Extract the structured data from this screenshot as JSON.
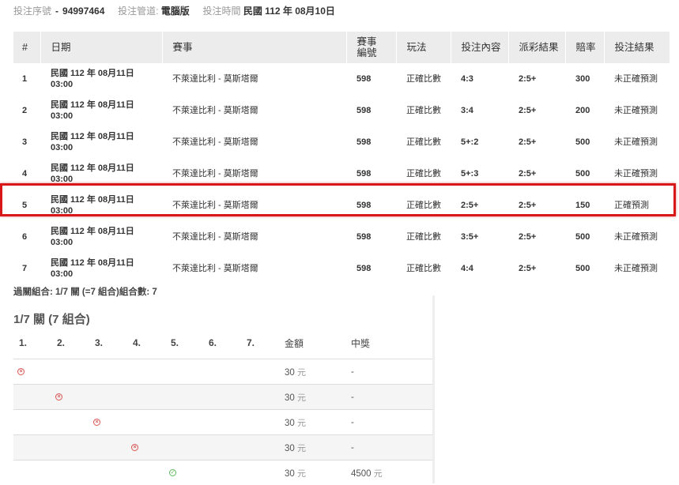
{
  "header": {
    "serial_label": "投注序號",
    "serial_value": "94997464",
    "channel_label": "投注管道:",
    "channel_value": "電腦版",
    "time_label": "投注時間",
    "time_value": "民國 112 年 08月10日"
  },
  "main_table": {
    "headers": [
      "#",
      "日期",
      "賽事",
      "賽事編號",
      "玩法",
      "投注內容",
      "派彩結果",
      "賠率",
      "投注結果"
    ],
    "rows": [
      {
        "num": "1",
        "date": "民國 112 年 08月11日",
        "time": "03:00",
        "event": "不萊達比利 - 莫斯塔爾",
        "code": "598",
        "play": "正確比數",
        "bet": "4:3",
        "payout": "2:5+",
        "odds": "300",
        "result": "未正確預測"
      },
      {
        "num": "2",
        "date": "民國 112 年 08月11日",
        "time": "03:00",
        "event": "不萊達比利 - 莫斯塔爾",
        "code": "598",
        "play": "正確比數",
        "bet": "3:4",
        "payout": "2:5+",
        "odds": "200",
        "result": "未正確預測"
      },
      {
        "num": "3",
        "date": "民國 112 年 08月11日",
        "time": "03:00",
        "event": "不萊達比利 - 莫斯塔爾",
        "code": "598",
        "play": "正確比數",
        "bet": "5+:2",
        "payout": "2:5+",
        "odds": "500",
        "result": "未正確預測"
      },
      {
        "num": "4",
        "date": "民國 112 年 08月11日",
        "time": "03:00",
        "event": "不萊達比利 - 莫斯塔爾",
        "code": "598",
        "play": "正確比數",
        "bet": "5+:3",
        "payout": "2:5+",
        "odds": "500",
        "result": "未正確預測"
      },
      {
        "num": "5",
        "date": "民國 112 年 08月11日",
        "time": "03:00",
        "event": "不萊達比利 - 莫斯塔爾",
        "code": "598",
        "play": "正確比數",
        "bet": "2:5+",
        "payout": "2:5+",
        "odds": "150",
        "result": "正確預測"
      },
      {
        "num": "6",
        "date": "民國 112 年 08月11日",
        "time": "03:00",
        "event": "不萊達比利 - 莫斯塔爾",
        "code": "598",
        "play": "正確比數",
        "bet": "3:5+",
        "payout": "2:5+",
        "odds": "500",
        "result": "未正確預測"
      },
      {
        "num": "7",
        "date": "民國 112 年 08月11日",
        "time": "03:00",
        "event": "不萊達比利 - 莫斯塔爾",
        "code": "598",
        "play": "正確比數",
        "bet": "4:4",
        "payout": "2:5+",
        "odds": "500",
        "result": "未正確預測"
      }
    ]
  },
  "summary": "過關組合: 1/7 關 (=7 組合)組合數: 7",
  "combo": {
    "title": "1/7 關 (7 組合)",
    "headers": [
      "1.",
      "2.",
      "3.",
      "4.",
      "5.",
      "6.",
      "7.",
      "金額",
      "中獎"
    ],
    "currency": "元",
    "rows": [
      {
        "col": 0,
        "status": "x",
        "amount": "30",
        "win": "-"
      },
      {
        "col": 1,
        "status": "x",
        "amount": "30",
        "win": "-"
      },
      {
        "col": 2,
        "status": "x",
        "amount": "30",
        "win": "-"
      },
      {
        "col": 3,
        "status": "x",
        "amount": "30",
        "win": "-"
      },
      {
        "col": 4,
        "status": "ok",
        "amount": "30",
        "win": "4500"
      }
    ]
  },
  "colors": {
    "highlight": "#d81818",
    "lose_icon": "#d9534f",
    "win_icon": "#5cb85c",
    "header_bg": "#ececec"
  }
}
